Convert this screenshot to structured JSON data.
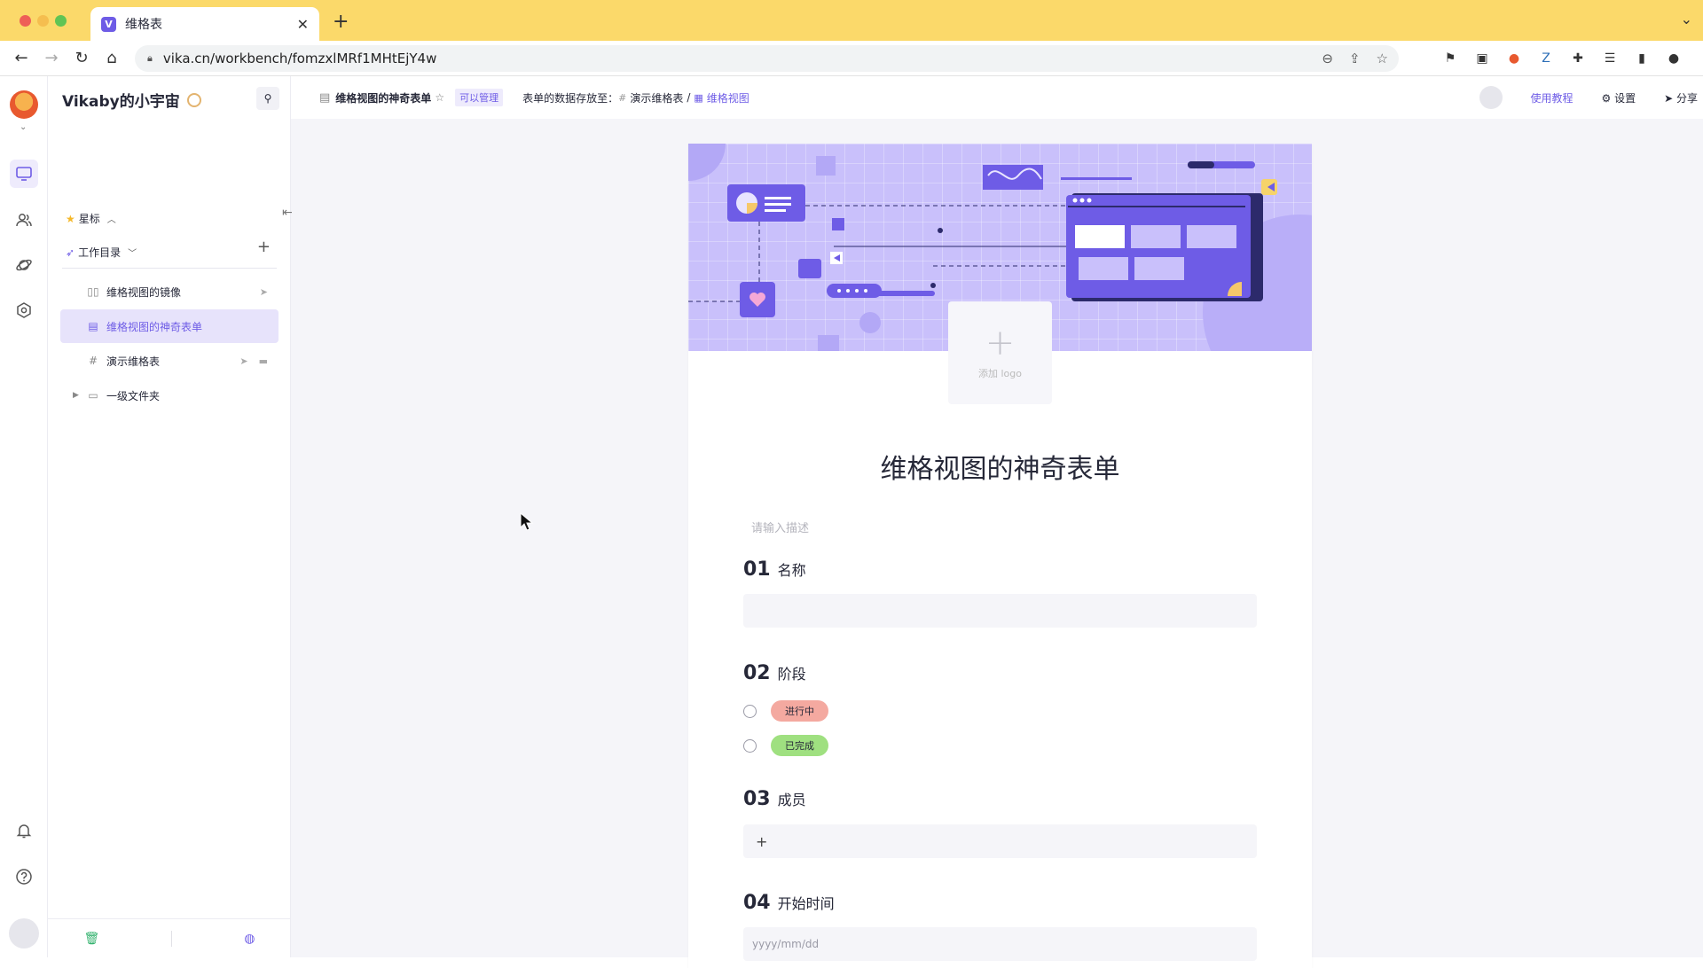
{
  "browser": {
    "tab_title": "维格表",
    "tab_close": "✕",
    "new_tab": "+",
    "url": "vika.cn/workbench/fomzxlMRf1MHtEjY4w"
  },
  "rail": {
    "icons": [
      "workbench-icon",
      "members-icon",
      "explore-icon",
      "settings-hex-icon",
      "bell-icon",
      "help-icon"
    ]
  },
  "sidebar": {
    "space_name": "Vikaby的小宇宙",
    "favorites_label": "星标",
    "catalog_label": "工作目录",
    "add": "+",
    "items": [
      {
        "label": "维格视图的镜像",
        "icon": "mirror-icon"
      },
      {
        "label": "维格视图的神奇表单",
        "icon": "form-icon"
      },
      {
        "label": "演示维格表",
        "icon": "datasheet-icon"
      },
      {
        "label": "一级文件夹",
        "icon": "folder-icon"
      }
    ]
  },
  "topbar": {
    "title": "维格视图的神奇表单",
    "permission": "可以管理",
    "storage_label": "表单的数据存放至：",
    "crumb_sheet": "演示维格表",
    "crumb_sep": "/",
    "crumb_view": "维格视图",
    "tutorial": "使用教程",
    "settings": "设置",
    "share": "分享"
  },
  "form": {
    "logo_add": "添加 logo",
    "title": "维格视图的神奇表单",
    "description_placeholder": "请输入描述",
    "questions": [
      {
        "num": "01",
        "label": "名称"
      },
      {
        "num": "02",
        "label": "阶段",
        "options": [
          {
            "label": "进行中",
            "color": "#f4a9a0"
          },
          {
            "label": "已完成",
            "color": "#9fe080"
          }
        ]
      },
      {
        "num": "03",
        "label": "成员",
        "add": "+"
      },
      {
        "num": "04",
        "label": "开始时间",
        "placeholder": "yyyy/mm/dd"
      }
    ]
  },
  "colors": {
    "accent": "#6e5ce6",
    "banner": "#c9c0fb",
    "chrome": "#fbd96a"
  }
}
